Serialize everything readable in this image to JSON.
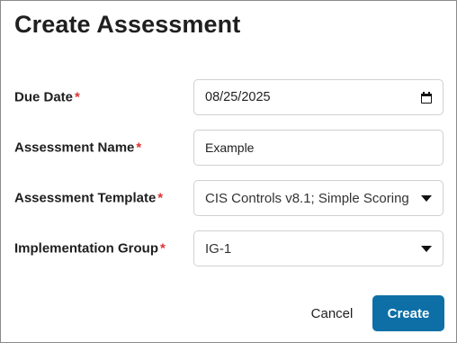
{
  "dialog": {
    "title": "Create Assessment",
    "required_marker": "*"
  },
  "form": {
    "due_date": {
      "label": "Due Date",
      "value": "08/25/2025",
      "icon": "calendar-icon"
    },
    "assessment_name": {
      "label": "Assessment Name",
      "value": "Example"
    },
    "assessment_template": {
      "label": "Assessment Template",
      "value": "CIS Controls v8.1; Simple Scoring",
      "icon": "chevron-down-icon"
    },
    "implementation_group": {
      "label": "Implementation Group",
      "value": "IG-1",
      "icon": "chevron-down-icon"
    }
  },
  "actions": {
    "cancel_label": "Cancel",
    "create_label": "Create"
  },
  "colors": {
    "primary": "#0d6fa6",
    "required": "#e03131",
    "border": "#d0d0d0"
  }
}
